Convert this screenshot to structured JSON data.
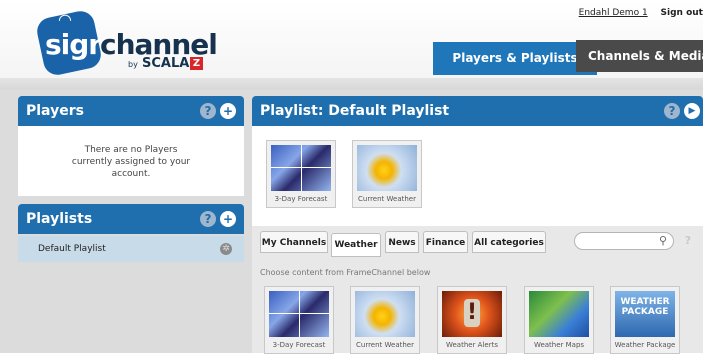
{
  "header": {
    "user_link": "Endahl Demo 1",
    "sign_out": "Sign out",
    "logo": {
      "sign": "sign",
      "channel": "channel",
      "by": "by",
      "scala": "SCALA",
      "mark": "Z"
    },
    "tabs": [
      {
        "label": "Players & Playlists",
        "active": true
      },
      {
        "label": "Channels & Media",
        "active": false
      }
    ]
  },
  "players_panel": {
    "title": "Players",
    "help_icon": "?",
    "add_icon": "+",
    "empty_message_line1": "There are no Players",
    "empty_message_line2": "currently assigned to your",
    "empty_message_line3": "account."
  },
  "playlists_panel": {
    "title": "Playlists",
    "help_icon": "?",
    "add_icon": "+",
    "items": [
      {
        "label": "Default Playlist"
      }
    ]
  },
  "playlist_panel": {
    "title": "Playlist: Default Playlist",
    "help_icon": "?",
    "play_icon": "▶",
    "items": [
      {
        "label": "3-Day Forecast"
      },
      {
        "label": "Current Weather"
      }
    ]
  },
  "content_browser": {
    "tabs": [
      {
        "label": "My Channels",
        "active": false
      },
      {
        "label": "Weather",
        "active": true
      },
      {
        "label": "News",
        "active": false
      },
      {
        "label": "Finance",
        "active": false
      },
      {
        "label": "All categories",
        "active": false
      }
    ],
    "search": {
      "placeholder": "",
      "icon": "search-icon"
    },
    "help_icon": "?",
    "hint": "Choose content from FrameChannel below",
    "items": [
      {
        "label": "3-Day Forecast"
      },
      {
        "label": "Current Weather"
      },
      {
        "label": "Weather Alerts"
      },
      {
        "label": "Weather Maps"
      },
      {
        "label": "Weather Package",
        "image_text_1": "WEATHER",
        "image_text_2": "PACKAGE"
      }
    ]
  },
  "colors": {
    "header_blue": "#1f6fae",
    "tab_blue": "#1f76b8",
    "tab_dark": "#4a4a4a",
    "row_highlight": "#c7dbe9"
  }
}
